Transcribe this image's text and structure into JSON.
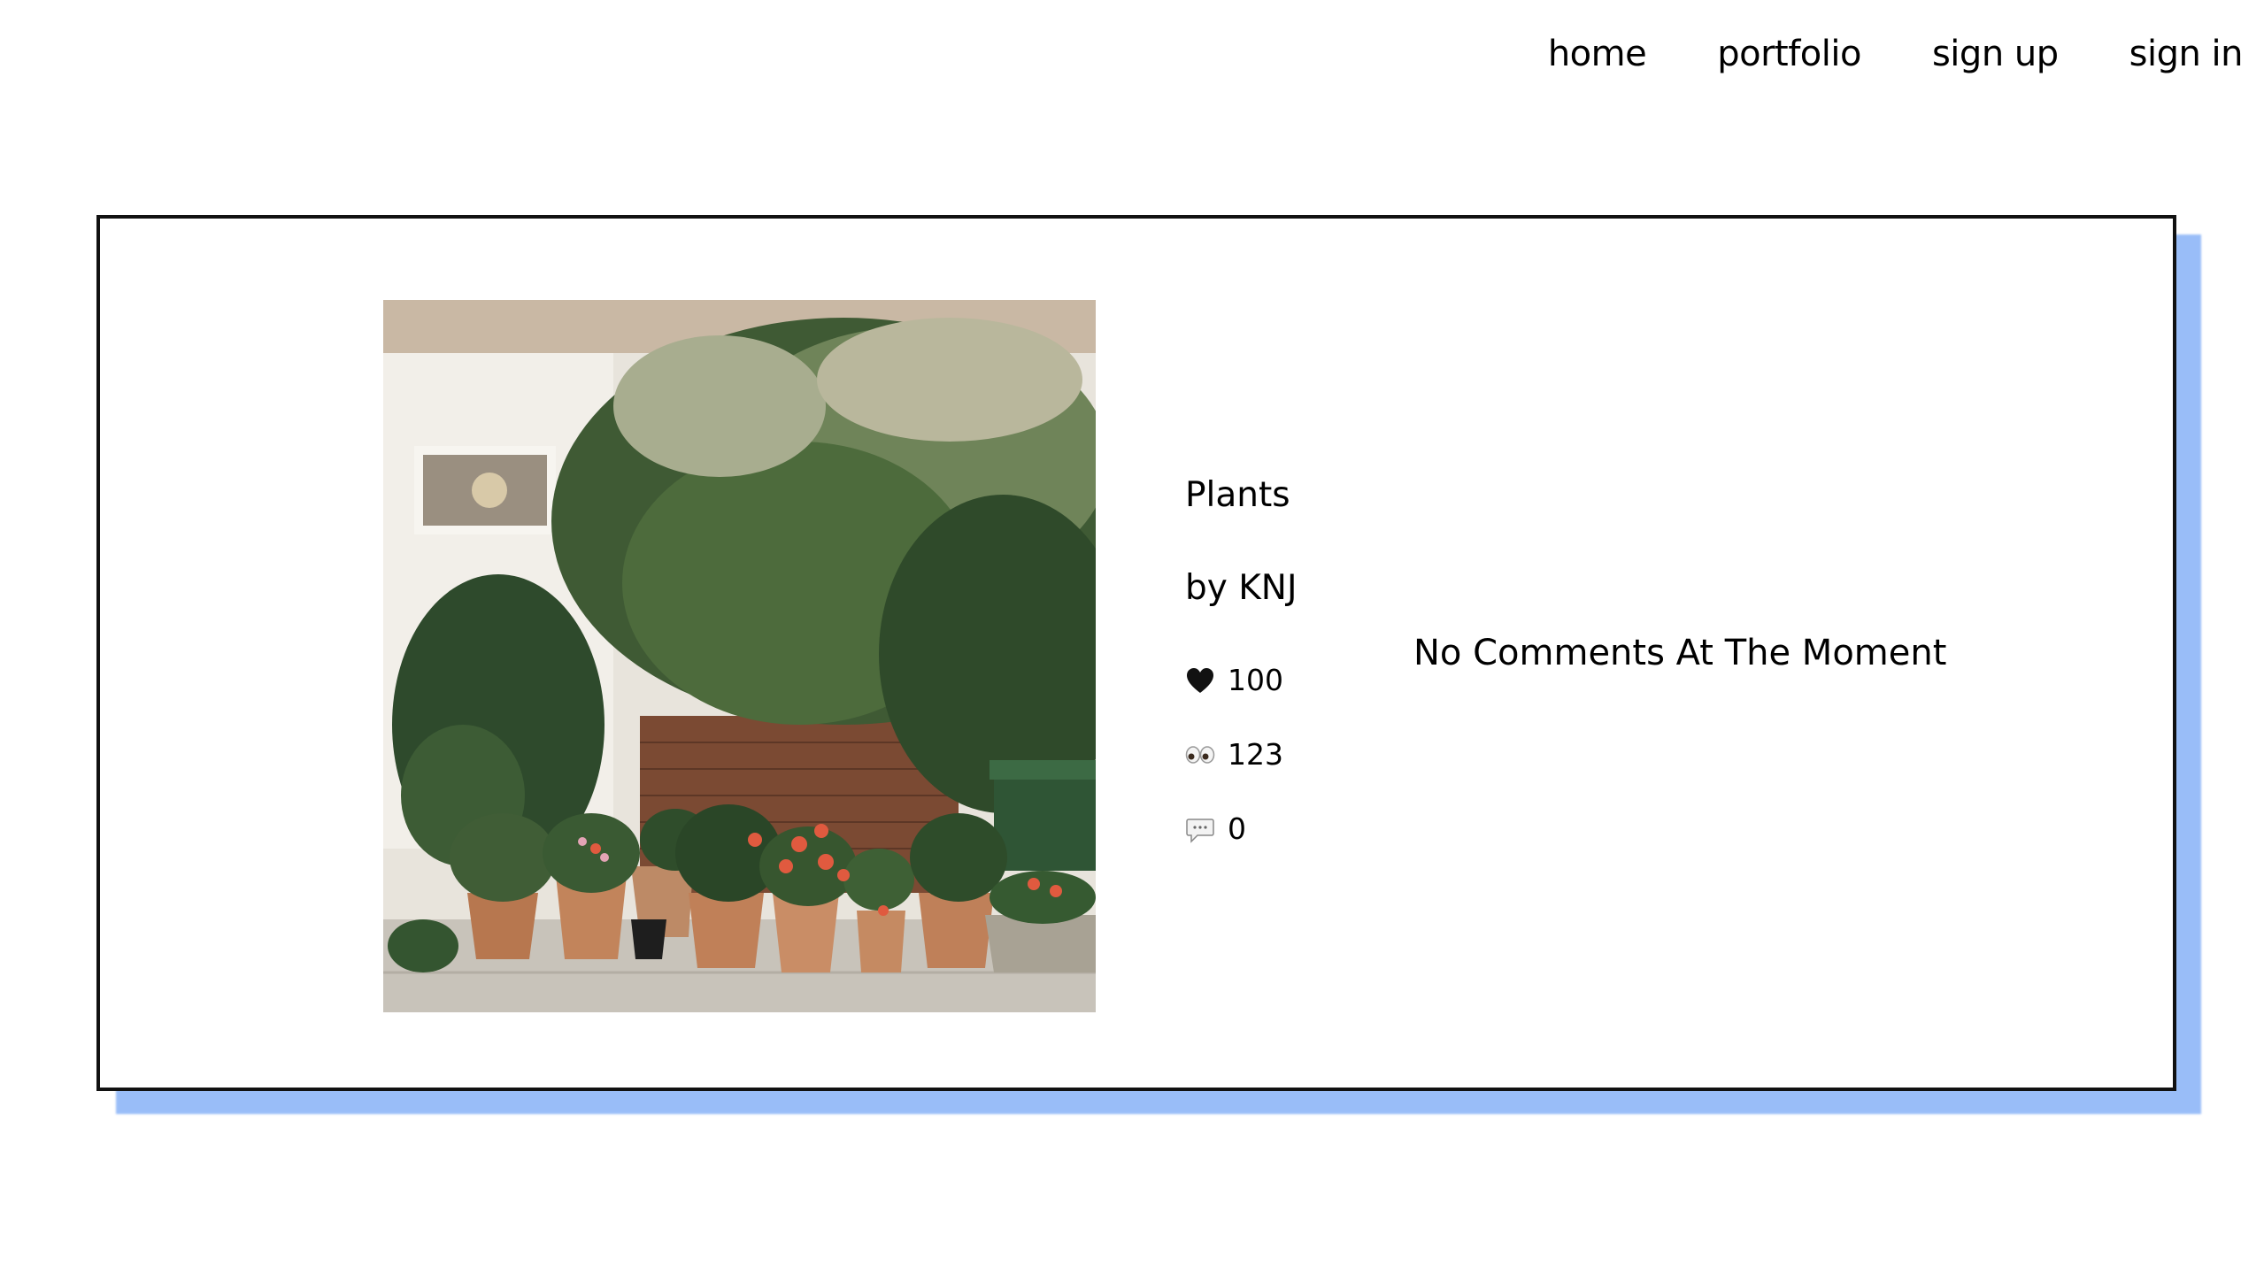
{
  "nav": {
    "items": [
      "home",
      "portfolio",
      "sign up",
      "sign in"
    ]
  },
  "post": {
    "title": "Plants",
    "author": "by KNJ",
    "likes": "100",
    "views": "123",
    "comments": "0",
    "comments_empty_text": "No Comments At The Moment"
  },
  "icons": {
    "likes": "heart-icon",
    "views": "eyes-icon",
    "comments": "speech-bubble-icon"
  },
  "colors": {
    "card_shadow": "#99bdf8",
    "card_border": "#111111"
  }
}
